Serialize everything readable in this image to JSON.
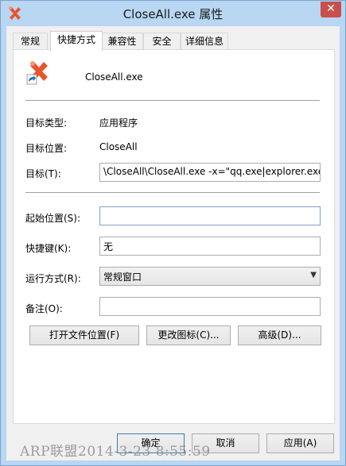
{
  "window": {
    "title": "CloseAll.exe 属性",
    "close_label": "✕"
  },
  "tabs": [
    {
      "label": "常规"
    },
    {
      "label": "快捷方式"
    },
    {
      "label": "兼容性"
    },
    {
      "label": "安全"
    },
    {
      "label": "详细信息"
    }
  ],
  "shortcut": {
    "name": "CloseAll.exe",
    "target_type_label": "目标类型:",
    "target_type": "应用程序",
    "target_location_label": "目标位置:",
    "target_location": "CloseAll",
    "target_label": "目标(T):",
    "target_value": "\\CloseAll\\CloseAll.exe -x=\"qq.exe|explorer.exe\"",
    "start_in_label": "起始位置(S):",
    "start_in_value": "",
    "hotkey_label": "快捷键(K):",
    "hotkey_value": "无",
    "run_label": "运行方式(R):",
    "run_value": "常规窗口",
    "comment_label": "备注(O):",
    "comment_value": "",
    "open_location_button": "打开文件位置(F)",
    "change_icon_button": "更改图标(C)...",
    "advanced_button": "高级(D)..."
  },
  "footer": {
    "ok_button": "确定",
    "cancel_button": "取消",
    "apply_button": "应用(A)"
  },
  "watermark": "ARP联盟2014-3-23 8:55:59",
  "colors": {
    "frame": "#b9d6f2",
    "close_button": "#c7504a",
    "icon_red": "#e8542e"
  }
}
